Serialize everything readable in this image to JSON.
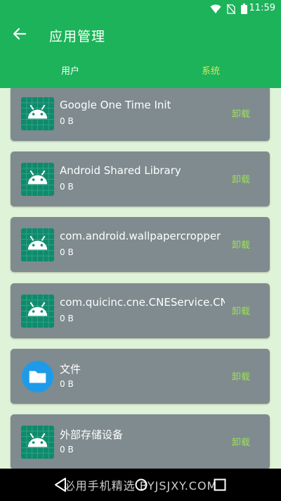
{
  "status_bar": {
    "time": "11:59",
    "icons": [
      "wifi-icon",
      "no-sim-icon",
      "battery-icon"
    ]
  },
  "app_bar": {
    "title": "应用管理",
    "back_icon": "arrow-left-icon",
    "tabs": [
      {
        "label": "用户",
        "active": true
      },
      {
        "label": "系统",
        "active": false
      }
    ]
  },
  "apps": [
    {
      "name": "Google One Time Init",
      "size": "0 B",
      "action": "卸载",
      "icon": "android-icon"
    },
    {
      "name": "Android Shared Library",
      "size": "0 B",
      "action": "卸载",
      "icon": "android-icon"
    },
    {
      "name": "com.android.wallpapercropper",
      "size": "0 B",
      "action": "卸载",
      "icon": "android-icon"
    },
    {
      "name": "com.quicinc.cne.CNEService.CN..",
      "size": "0 B",
      "action": "卸载",
      "icon": "android-icon"
    },
    {
      "name": "文件",
      "size": "0 B",
      "action": "卸载",
      "icon": "folder-icon"
    },
    {
      "name": "外部存储设备",
      "size": "0 B",
      "action": "卸载",
      "icon": "android-icon"
    }
  ],
  "watermark": "必用手机精选 BYJSJXY.COM",
  "colors": {
    "accent": "#1db35a",
    "background": "#dff3d8",
    "card": "#7f8b8e",
    "action": "#9be05a",
    "tab_inactive": "#cfe86b"
  }
}
